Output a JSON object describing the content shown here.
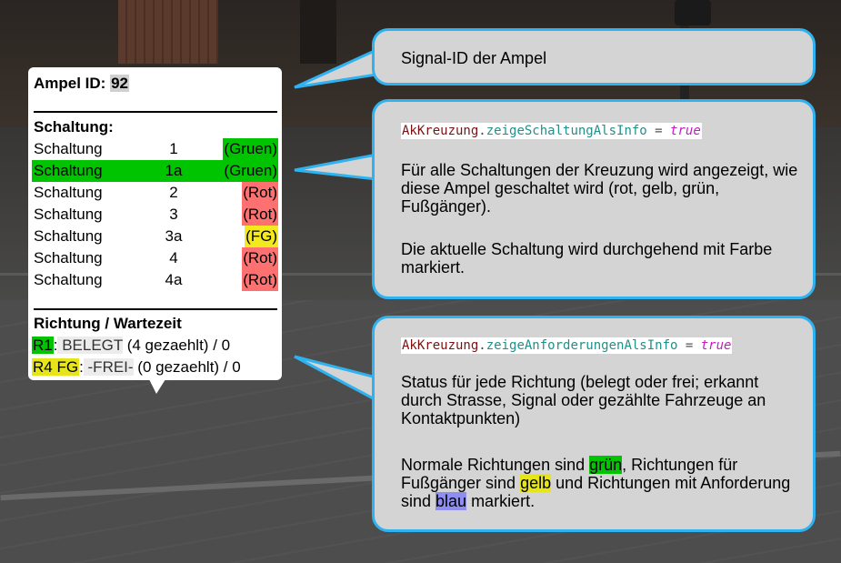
{
  "info_panel": {
    "title_label": "Ampel ID:",
    "id_value": "92",
    "schaltung_heading": "Schaltung:",
    "schaltungen": [
      {
        "name": "Schaltung",
        "num": "1",
        "state": "(Gruen)"
      },
      {
        "name": "Schaltung",
        "num": "1a",
        "state": "(Gruen)"
      },
      {
        "name": "Schaltung",
        "num": "2",
        "state": "(Rot)"
      },
      {
        "name": "Schaltung",
        "num": "3",
        "state": "(Rot)"
      },
      {
        "name": "Schaltung",
        "num": "3a",
        "state": "(FG)"
      },
      {
        "name": "Schaltung",
        "num": "4",
        "state": "(Rot)"
      },
      {
        "name": "Schaltung",
        "num": "4a",
        "state": "(Rot)"
      }
    ],
    "richtung_heading": "Richtung / Wartezeit",
    "richtungen": [
      {
        "tag": "R1",
        "sep": ":",
        "status": " BELEGT",
        "detail": " (4 gezaehlt) / 0"
      },
      {
        "tag": "R4 FG",
        "sep": ":",
        "status": " -FREI-",
        "detail": " (0 gezaehlt) / 0"
      }
    ]
  },
  "callout_1": {
    "text": "Signal-ID der Ampel"
  },
  "callout_2": {
    "code_obj": "AkKreuzung",
    "code_dot": ".",
    "code_prop": "zeigeSchaltungAlsInfo",
    "code_eq": " = ",
    "code_val": "true",
    "para1": "Für alle Schaltungen der Kreuzung wird angezeigt, wie diese Ampel geschaltet wird (rot, gelb, grün, Fußgänger).",
    "para2": "Die aktuelle Schaltung wird durchgehend mit Farbe markiert."
  },
  "callout_3": {
    "code_obj": "AkKreuzung",
    "code_dot": ".",
    "code_prop": "zeigeAnforderungenAlsInfo",
    "code_eq": " = ",
    "code_val": "true",
    "para1": "Status für jede Richtung (belegt oder frei; erkannt durch Strasse, Signal oder gezählte Fahrzeuge an Kontaktpunkten)",
    "para2_a": "Normale Richtungen sind ",
    "para2_green": "grün",
    "para2_b": ", Richtungen für Fußgänger sind ",
    "para2_yellow": "gelb",
    "para2_c": " und Richtungen mit Anforderung sind ",
    "para2_blue": "blau",
    "para2_d": " markiert."
  },
  "colors": {
    "callout_border": "#2fb2f0",
    "callout_bg": "#d4d4d4",
    "green": "#00c400",
    "red": "#ff7070",
    "yellow": "#f2ea1e",
    "blue": "#8e8ef0"
  }
}
